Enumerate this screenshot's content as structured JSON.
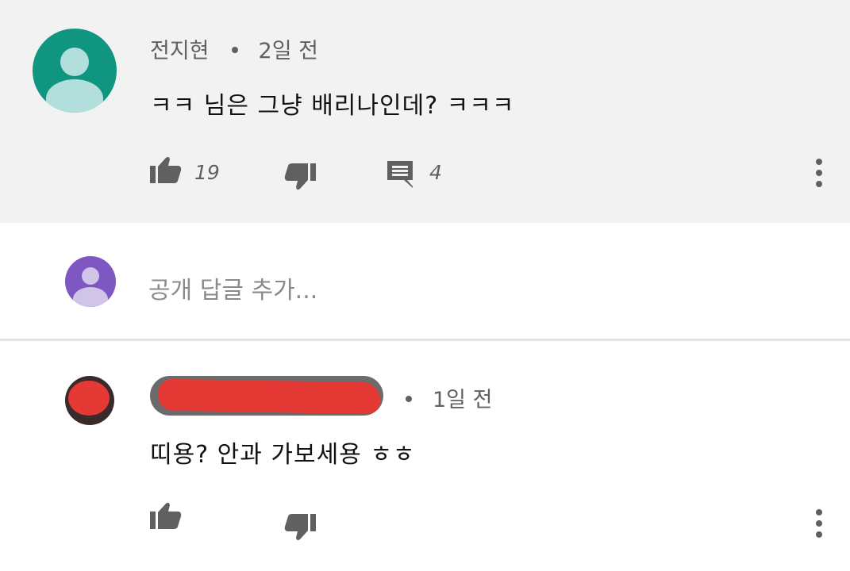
{
  "comments": [
    {
      "author": "전지현",
      "time": "2일 전",
      "text": "ㅋㅋ 님은 그냥 배리나인데? ㅋㅋㅋ",
      "likes": "19",
      "replies": "4",
      "avatar_color": "#0f9580",
      "icons": [
        "like-icon",
        "dislike-icon",
        "reply-icon",
        "more-icon"
      ]
    },
    {
      "author": "",
      "time": "1일 전",
      "text": "띠용? 안과 가보세용 ㅎㅎ",
      "avatar_color": "#e53935",
      "icons": [
        "like-icon",
        "dislike-icon",
        "more-icon"
      ]
    }
  ],
  "reply_box": {
    "placeholder": "공개 답글 추가...",
    "avatar_color": "#7e57c2"
  }
}
